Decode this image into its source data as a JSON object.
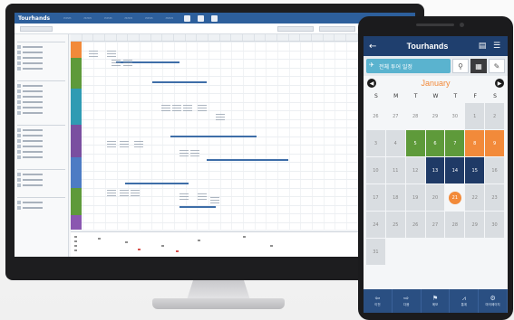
{
  "desktop": {
    "brand": "Tourhands",
    "menu": [
      "",
      "",
      "",
      "",
      "",
      "",
      ""
    ]
  },
  "phone": {
    "app_title": "Tourhands",
    "search_value": "전체 투어 일정",
    "month": "January",
    "weekdays": [
      "S",
      "M",
      "T",
      "W",
      "T",
      "F",
      "S"
    ],
    "weeks": [
      [
        {
          "d": "26",
          "s": "plain"
        },
        {
          "d": "27",
          "s": "plain"
        },
        {
          "d": "28",
          "s": "plain"
        },
        {
          "d": "29",
          "s": "plain"
        },
        {
          "d": "30",
          "s": "plain"
        },
        {
          "d": "1",
          "s": "grey"
        },
        {
          "d": "2",
          "s": "grey"
        }
      ],
      [
        {
          "d": "3",
          "s": "grey"
        },
        {
          "d": "4",
          "s": "grey"
        },
        {
          "d": "5",
          "s": "green"
        },
        {
          "d": "6",
          "s": "green"
        },
        {
          "d": "7",
          "s": "green"
        },
        {
          "d": "8",
          "s": "orange"
        },
        {
          "d": "9",
          "s": "orange"
        }
      ],
      [
        {
          "d": "10",
          "s": "grey"
        },
        {
          "d": "11",
          "s": "grey"
        },
        {
          "d": "12",
          "s": "grey"
        },
        {
          "d": "13",
          "s": "navy"
        },
        {
          "d": "14",
          "s": "navy"
        },
        {
          "d": "15",
          "s": "navy"
        },
        {
          "d": "16",
          "s": "grey"
        }
      ],
      [
        {
          "d": "17",
          "s": "grey"
        },
        {
          "d": "18",
          "s": "grey"
        },
        {
          "d": "19",
          "s": "grey"
        },
        {
          "d": "20",
          "s": "grey"
        },
        {
          "d": "21",
          "s": "today"
        },
        {
          "d": "22",
          "s": "grey"
        },
        {
          "d": "23",
          "s": "grey"
        }
      ],
      [
        {
          "d": "24",
          "s": "grey"
        },
        {
          "d": "25",
          "s": "grey"
        },
        {
          "d": "26",
          "s": "grey"
        },
        {
          "d": "27",
          "s": "grey"
        },
        {
          "d": "28",
          "s": "grey"
        },
        {
          "d": "29",
          "s": "grey"
        },
        {
          "d": "30",
          "s": "grey"
        }
      ],
      [
        {
          "d": "31",
          "s": "grey"
        },
        {
          "d": "",
          "s": "plain"
        },
        {
          "d": "",
          "s": "plain"
        },
        {
          "d": "",
          "s": "plain"
        },
        {
          "d": "",
          "s": "plain"
        },
        {
          "d": "",
          "s": "plain"
        },
        {
          "d": "",
          "s": "plain"
        }
      ]
    ],
    "tabs": [
      {
        "label": "이전",
        "icon": "arrow-left-icon"
      },
      {
        "label": "다음",
        "icon": "arrow-right-icon"
      },
      {
        "label": "메모",
        "icon": "flag-icon"
      },
      {
        "label": "통계",
        "icon": "chart-icon"
      },
      {
        "label": "마이페이지",
        "icon": "gear-icon"
      }
    ]
  },
  "colors": {
    "navy": "#1f3f6e",
    "accent_orange": "#f28a3a",
    "green": "#5e9a3a",
    "search_blue": "#5ab3cf"
  }
}
